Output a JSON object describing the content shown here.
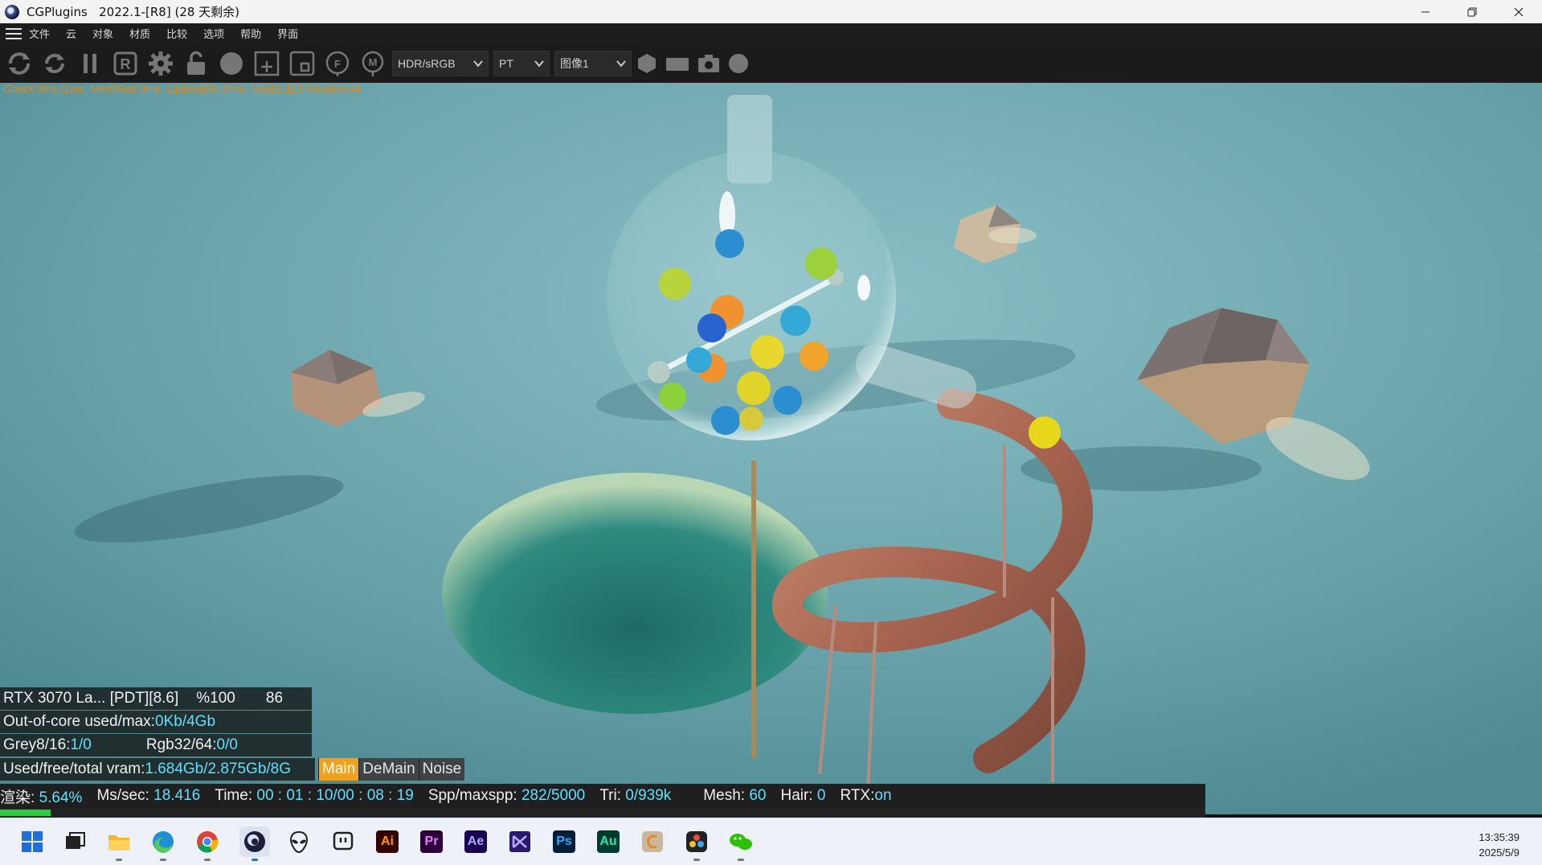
{
  "window": {
    "title": "CGPlugins   2022.1-[R8] (28 天剩余)",
    "icons": [
      "cinema4d-icon",
      "minimize-icon",
      "restore-icon",
      "close-icon"
    ]
  },
  "menu": {
    "items": [
      "文件",
      "云",
      "对象",
      "材质",
      "比较",
      "选项",
      "帮助",
      "界面"
    ]
  },
  "toolbar": {
    "icons": [
      "settings-cycle-icon",
      "refresh-icon",
      "pause-icon",
      "r-icon",
      "gear-icon",
      "unlock-icon",
      "sphere-icon",
      "add-region-icon",
      "region-icon",
      "f-icon",
      "m-icon"
    ],
    "select_tonemap": "HDR/sRGB",
    "select_kernel": "PT",
    "select_image": "图像1",
    "extra_icons": [
      "shape-hex-icon",
      "rect-icon",
      "camera-icon",
      "circle-icon"
    ]
  },
  "stats_line": "Check:0ms./1ms. MeshGen:0ms. Update[Gli]:0ms. Nodes:110 Movable:44",
  "info": {
    "gpu_name": "RTX 3070 La... [PDT][8.6]",
    "gpu_percent": "%100",
    "gpu_temp": "86",
    "ooc_label": "Out-of-core used/max:",
    "ooc_value": "0Kb/4Gb",
    "grey_label": "Grey8/16: ",
    "grey_value": "1/0",
    "rgb_label": "Rgb32/64: ",
    "rgb_value": "0/0",
    "vram_label": "Used/free/total vram: ",
    "vram_value": "1.684Gb/2.875Gb/8G"
  },
  "tabs": [
    {
      "label": "Main",
      "active": true
    },
    {
      "label": "DeMain",
      "active": false
    },
    {
      "label": "Noise",
      "active": false
    }
  ],
  "status": {
    "render_label": "渲染: ",
    "render_value": "5.64%",
    "ms_label": "Ms/sec: ",
    "ms_value": "18.416",
    "time_label": "Time: ",
    "time_value": "00 : 01 : 10/00 : 08 : 19",
    "spp_label": "Spp/maxspp: ",
    "spp_value": "282/5000",
    "tri_label": "Tri: ",
    "tri_value": "0/939k",
    "mesh_label": "Mesh: ",
    "mesh_value": "60",
    "hair_label": "Hair: ",
    "hair_value": "0",
    "rtx_label": "RTX:",
    "rtx_value": "on",
    "progress": 0.0564
  },
  "taskbar": {
    "icons": [
      "windows-start-icon",
      "task-view-icon",
      "file-explorer-icon",
      "edge-icon",
      "chrome-icon",
      "cinema4d-icon",
      "alienware-icon",
      "twitch-icon",
      "illustrator-icon",
      "premiere-icon",
      "after-effects-icon",
      "visual-studio-icon",
      "photoshop-icon",
      "audition-icon",
      "c-app-icon",
      "davinci-icon",
      "wechat-icon"
    ],
    "adobe_labels": {
      "ai": "Ai",
      "pr": "Pr",
      "ae": "Ae",
      "ps": "Ps",
      "au": "Au"
    },
    "time": "13:35:39",
    "date": "2025/5/9"
  },
  "colors": {
    "stats_orange": "#e08a1a",
    "value_cyan": "#5ee0ff",
    "tab_active": "#f0a21c",
    "progress_green": "#2ecc40",
    "ground": "#6fa4ab"
  }
}
